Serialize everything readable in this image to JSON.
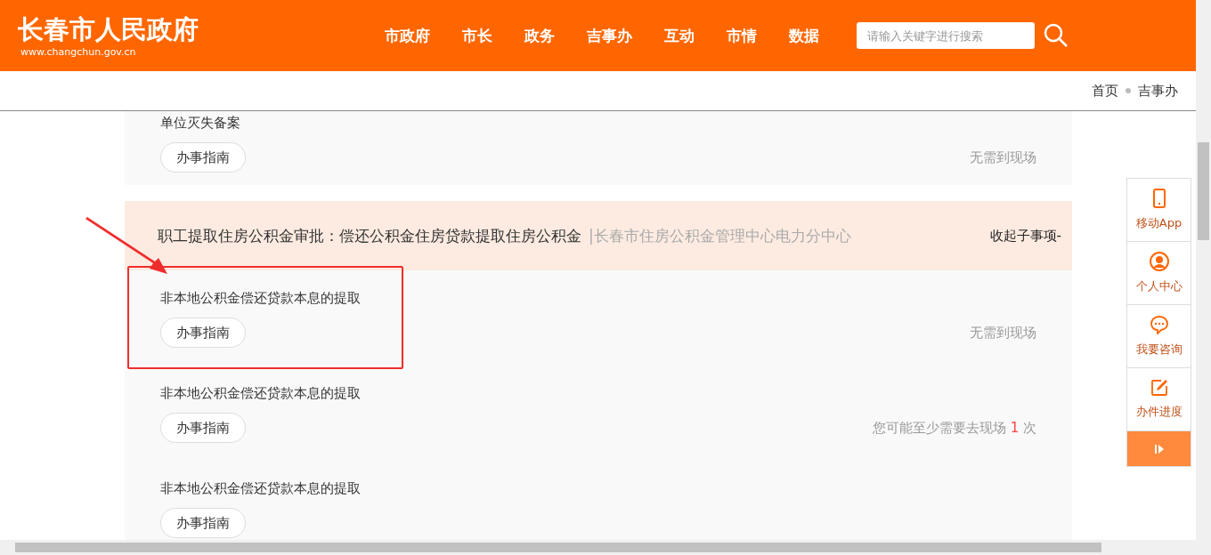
{
  "header": {
    "title": "长春市人民政府",
    "url": "www.changchun.gov.cn",
    "nav": [
      {
        "label": "市政府"
      },
      {
        "label": "市长"
      },
      {
        "label": "政务"
      },
      {
        "label": "吉事办"
      },
      {
        "label": "互动"
      },
      {
        "label": "市情"
      },
      {
        "label": "数据"
      }
    ],
    "search": {
      "placeholder": "请输入关键字进行搜索"
    }
  },
  "breadcrumb": [
    "首页",
    "吉事办"
  ],
  "top_item": {
    "title": "单位灭失备案",
    "button": "办事指南",
    "note": {
      "kind": "plain",
      "text": "无需到现场"
    }
  },
  "group": {
    "title": "职工提取住房公积金审批：偿还公积金住房贷款提取住房公积金",
    "department": "|长春市住房公积金管理中心电力分中心",
    "toggle": "收起子事项-",
    "items": [
      {
        "title": "非本地公积金偿还贷款本息的提取",
        "button": "办事指南",
        "highlighted": true,
        "note": {
          "kind": "plain",
          "text": "无需到现场"
        }
      },
      {
        "title": "非本地公积金偿还贷款本息的提取",
        "button": "办事指南",
        "highlighted": false,
        "note": {
          "kind": "visits",
          "prefix": "您可能至少需要去现场",
          "count": "1",
          "suffix": "次"
        }
      },
      {
        "title": "非本地公积金偿还贷款本息的提取",
        "button": "办事指南",
        "highlighted": false
      }
    ]
  },
  "side_toolbar": [
    {
      "kind": "phone",
      "label": "移动App"
    },
    {
      "kind": "user",
      "label": "个人中心"
    },
    {
      "kind": "chat",
      "label": "我要咨询"
    },
    {
      "kind": "edit",
      "label": "办件进度"
    },
    {
      "kind": "collapse"
    }
  ]
}
